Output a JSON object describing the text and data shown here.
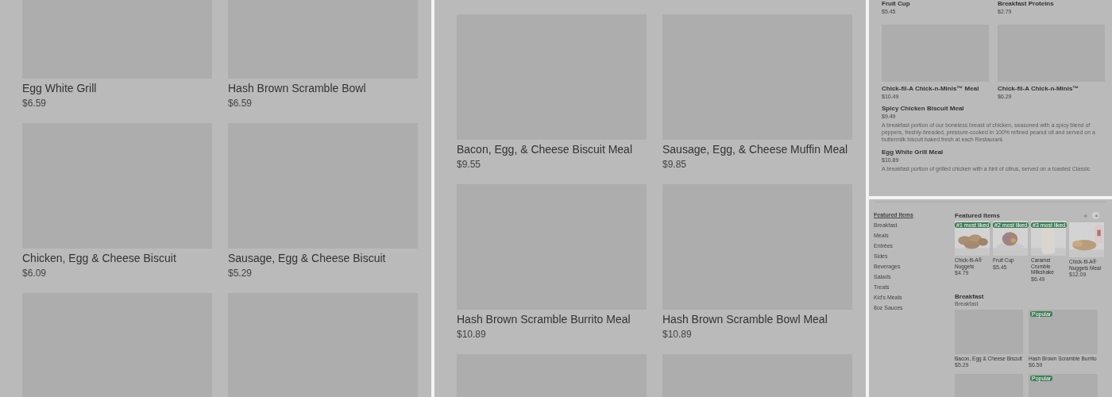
{
  "panels": [
    {
      "kind": "grid",
      "items": [
        {
          "kind": "card",
          "name": "Egg White Grill",
          "price": "$6.59"
        },
        {
          "kind": "card",
          "name": "Hash Brown Scramble Bowl",
          "price": "$6.59"
        },
        {
          "kind": "card",
          "name": "Chicken, Egg & Cheese Biscuit",
          "price": "$6.09"
        },
        {
          "kind": "card",
          "name": "Sausage, Egg & Cheese Biscuit",
          "price": "$5.29"
        },
        {
          "kind": "image_only"
        },
        {
          "kind": "image_only"
        }
      ]
    },
    {
      "kind": "grid",
      "items": [
        {
          "kind": "card",
          "name": "Bacon, Egg, & Cheese Biscuit Meal",
          "price": "$9.55"
        },
        {
          "kind": "card",
          "name": "Sausage, Egg, & Cheese Muffin Meal",
          "price": "$9.85"
        },
        {
          "kind": "card",
          "name": "Hash Brown Scramble Burrito Meal",
          "price": "$10.89"
        },
        {
          "kind": "card",
          "name": "Hash Brown Scramble Bowl Meal",
          "price": "$10.89"
        },
        {
          "kind": "image_only"
        },
        {
          "kind": "image_only"
        }
      ]
    },
    {
      "kind": "stack",
      "sections": [
        {
          "kind": "pair",
          "items": [
            {
              "kind": "text_only",
              "name": "Fruit Cup",
              "price": "$5.45"
            },
            {
              "kind": "text_only",
              "name": "Breakfast Proteins",
              "price": "$2.79"
            }
          ]
        },
        {
          "kind": "pair",
          "items": [
            {
              "kind": "card",
              "name": "Chick-fil-A Chick-n-Minis™ Meal",
              "price": "$10.49"
            },
            {
              "kind": "card",
              "name": "Chick-fil-A Chick-n-Minis™",
              "price": "$6.29"
            }
          ]
        },
        {
          "kind": "detail",
          "name": "Spicy Chicken Biscuit Meal",
          "price": "$9.49",
          "description": "A breakfast portion of our boneless breast of chicken, seasoned with a spicy blend of peppers, freshly-breaded, pressure-cooked in 100% refined peanut oil and served on a buttermilk biscuit baked fresh at each Restaurant."
        },
        {
          "kind": "detail",
          "name": "Egg White Grill Meal",
          "price": "$10.89",
          "description": "A breakfast portion of grilled chicken with a hint of citrus, served on a toasted Classic"
        }
      ]
    },
    {
      "kind": "menu",
      "sidebar": [
        {
          "label": "Featured Items",
          "selected": true
        },
        {
          "label": "Breakfast",
          "selected": false
        },
        {
          "label": "Meals",
          "selected": false
        },
        {
          "label": "Entrées",
          "selected": false
        },
        {
          "label": "Sides",
          "selected": false
        },
        {
          "label": "Beverages",
          "selected": false
        },
        {
          "label": "Salads",
          "selected": false
        },
        {
          "label": "Treats",
          "selected": false
        },
        {
          "label": "Kid's Meals",
          "selected": false
        },
        {
          "label": "8oz Sauces",
          "selected": false
        }
      ],
      "featured": {
        "title": "Featured Items",
        "items": [
          {
            "badge": "#1 most liked",
            "name": "Chick-fil-A® Nuggets",
            "price": "$4.79"
          },
          {
            "badge": "#2 most liked",
            "name": "Fruit Cup",
            "price": "$5.45"
          },
          {
            "badge": "#3 most liked",
            "name": "Caramel Crumble Milkshake",
            "price": "$6.49"
          },
          {
            "name": "Chick-fil-A® Nuggets Meal",
            "price": "$12.09"
          }
        ]
      },
      "section": {
        "title": "Breakfast",
        "subtitle": "Breakfast",
        "items": [
          {
            "kind": "card",
            "name": "Bacon, Egg & Cheese Biscuit",
            "price": "$5.29"
          },
          {
            "kind": "card",
            "badge": "Popular",
            "name": "Hash Brown Scramble Burrito",
            "price": "$6.59"
          },
          {
            "kind": "image_only"
          },
          {
            "kind": "image_only",
            "badge": "Popular"
          }
        ]
      }
    }
  ]
}
